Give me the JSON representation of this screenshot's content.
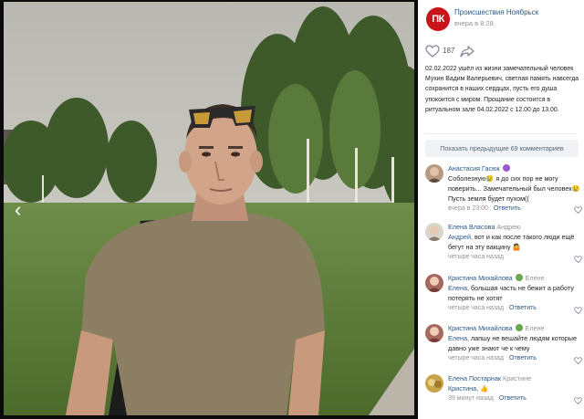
{
  "viewer": {
    "prev_arrow": "‹"
  },
  "post": {
    "group_name": "Происшествия Ноябрьск",
    "group_logo_text": "ПК",
    "time": "вчера в 8:28",
    "likes": "187",
    "text": "02.02.2022 ушёл из жизни замечательный человек Мухин Вадим Валерьевич, светлая память навсегда сохранится в наших сердцах, пусть его душа упокоится с миром. Прощание состоится в ритуальном зале 04.02.2022 с 12.00 до 13.00."
  },
  "comments_panel": {
    "show_previous": "Показать предыдущие 69 комментариев",
    "answer_label": "Ответить"
  },
  "comments": [
    {
      "author": "Анастасия Гасюк",
      "reply_to": "",
      "mention": "",
      "text": "Соболезную😢 я до сих пор не могу поверить... Замечательный был человек😢Пусть земля будет пухом((",
      "time": "вчера в 23:00"
    },
    {
      "author": "Елена Власова",
      "reply_to": "Андрею",
      "mention": "Андрей,",
      "text": " вот и как после такого люди ещё бегут на эту вакцину 🤷",
      "time": "четыре часа назад"
    },
    {
      "author": "Кристина Михайлова",
      "reply_to": "Елене",
      "mention": "Елена,",
      "text": " большая часть не бежит а работу потерять не хотят",
      "time": "четыре часа назад"
    },
    {
      "author": "Кристина Михайлова",
      "reply_to": "Елене",
      "mention": "Елена,",
      "text": " лапшу не вешайте людям которые давно уже знают че к чему",
      "time": "четыре часа назад"
    },
    {
      "author": "Елена Постарнак",
      "reply_to": "Кристине",
      "mention": "Кристина,",
      "text": " 👍",
      "time": "39 минут назад"
    }
  ],
  "colors": {
    "link": "#2a5885",
    "muted": "#939393",
    "brand_red": "#c8151b"
  },
  "icons": [
    "chevron-left-icon",
    "heart-icon",
    "share-icon"
  ]
}
